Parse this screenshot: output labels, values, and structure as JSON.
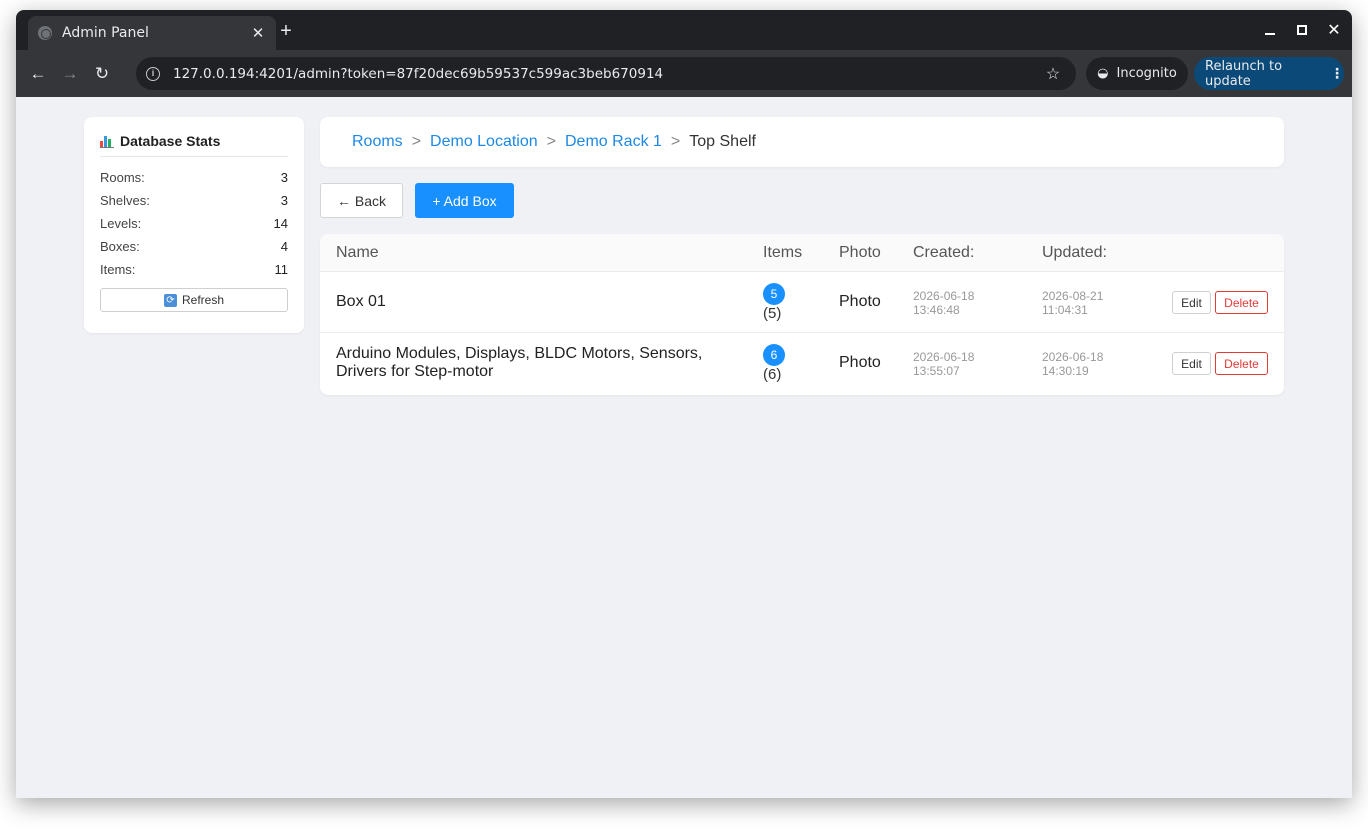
{
  "browser": {
    "tab_title": "Admin Panel",
    "tab_close": "✕",
    "new_tab": "+",
    "url": "127.0.0.194:4201/admin?token=87f20dec69b59537c599ac3beb670914",
    "incognito_label": "Incognito",
    "relaunch_label": "Relaunch to update",
    "relaunch_color": "#0b4a78"
  },
  "sidebar": {
    "title": "Database Stats",
    "stats": [
      {
        "label": "Rooms:",
        "value": "3"
      },
      {
        "label": "Shelves:",
        "value": "3"
      },
      {
        "label": "Levels:",
        "value": "14"
      },
      {
        "label": "Boxes:",
        "value": "4"
      },
      {
        "label": "Items:",
        "value": "11"
      }
    ],
    "refresh_label": "Refresh"
  },
  "breadcrumb": {
    "items": [
      {
        "label": "Rooms"
      },
      {
        "label": "Demo Location"
      },
      {
        "label": "Demo Rack 1"
      }
    ],
    "separator": ">",
    "current": "Top Shelf"
  },
  "actions": {
    "back_label": "← Back",
    "add_label": "+ Add Box"
  },
  "table": {
    "headers": {
      "name": "Name",
      "items": "Items",
      "photo": "Photo",
      "created": "Created:",
      "updated": "Updated:"
    },
    "rows": [
      {
        "name": "Box 01",
        "items_badge": "5",
        "items_count": "(5)",
        "photo": "Photo",
        "created_date": "2026-06-18",
        "created_time": "13:46:48",
        "updated_date": "2026-08-21",
        "updated_time": "11:04:31",
        "edit": "Edit",
        "delete": "Delete"
      },
      {
        "name": "Arduino Modules, Displays, BLDC Motors, Sensors, Drivers for Step-motor",
        "items_badge": "6",
        "items_count": "(6)",
        "photo": "Photo",
        "created_date": "2026-06-18",
        "created_time": "13:55:07",
        "updated_date": "2026-06-18",
        "updated_time": "14:30:19",
        "edit": "Edit",
        "delete": "Delete"
      }
    ]
  },
  "colors": {
    "accent": "#1890ff",
    "link": "#1e88e5",
    "danger": "#e53935",
    "page_bg": "#f0f1f5"
  }
}
